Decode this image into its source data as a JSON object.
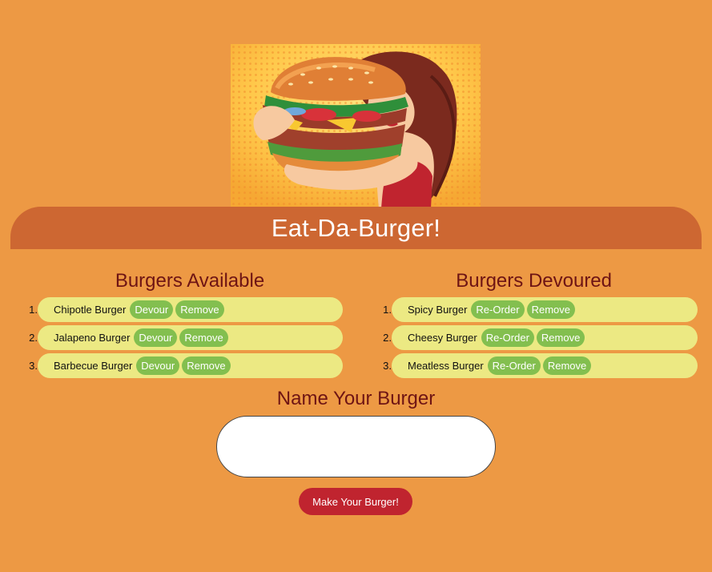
{
  "hero": {
    "image": "burger-hug-illustration"
  },
  "header": {
    "title": "Eat-Da-Burger!"
  },
  "available": {
    "heading": "Burgers Available",
    "items": [
      {
        "num": "1.",
        "name": "Chipotle Burger",
        "action": "Devour",
        "remove": "Remove"
      },
      {
        "num": "2.",
        "name": "Jalapeno Burger",
        "action": "Devour",
        "remove": "Remove"
      },
      {
        "num": "3.",
        "name": "Barbecue Burger",
        "action": "Devour",
        "remove": "Remove"
      }
    ]
  },
  "devoured": {
    "heading": "Burgers Devoured",
    "items": [
      {
        "num": "1.",
        "name": "Spicy Burger",
        "action": "Re-Order",
        "remove": "Remove"
      },
      {
        "num": "2.",
        "name": "Cheesy Burger",
        "action": "Re-Order",
        "remove": "Remove"
      },
      {
        "num": "3.",
        "name": "Meatless Burger",
        "action": "Re-Order",
        "remove": "Remove"
      }
    ]
  },
  "form": {
    "title": "Name Your Burger",
    "input_value": "",
    "submit_label": "Make Your Burger!"
  },
  "colors": {
    "background": "#ed9944",
    "banner": "#cd6732",
    "heading": "#6e1414",
    "item_pill": "#ece983",
    "action_button": "#83bf4f",
    "submit_button": "#c0242f"
  }
}
